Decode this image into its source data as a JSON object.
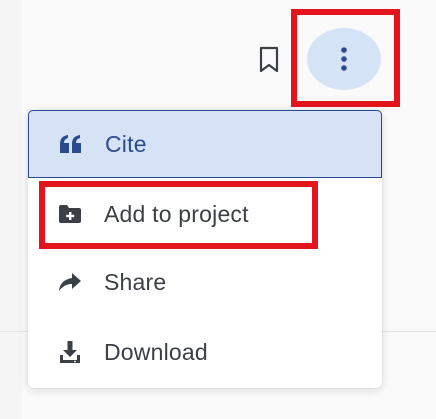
{
  "toolbar": {
    "bookmark_icon": "bookmark-outline-icon",
    "more_icon": "more-vertical-icon"
  },
  "menu": {
    "items": [
      {
        "label": "Cite",
        "icon": "quote-icon",
        "active": true
      },
      {
        "label": "Add to project",
        "icon": "folder-plus-icon",
        "active": false
      },
      {
        "label": "Share",
        "icon": "share-arrow-icon",
        "active": false
      },
      {
        "label": "Download",
        "icon": "download-icon",
        "active": false
      }
    ]
  },
  "colors": {
    "accent": "#2a4c8c",
    "active_bg": "#d6e3f7",
    "highlight": "#e3141c",
    "text": "#3b3f46"
  }
}
